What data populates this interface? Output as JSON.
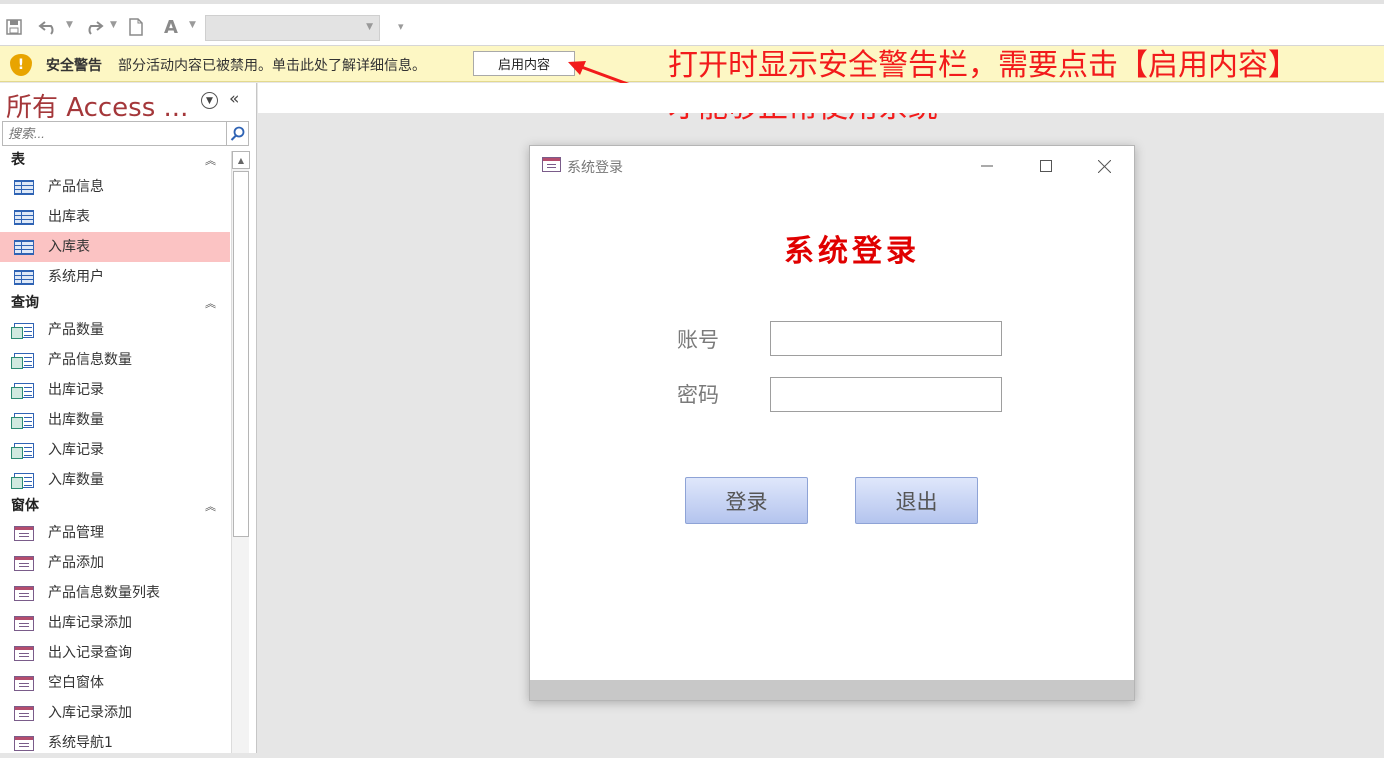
{
  "security_bar": {
    "title": "安全警告",
    "message": "部分活动内容已被禁用。单击此处了解详细信息。",
    "enable_button": "启用内容"
  },
  "annotation": {
    "line1": "打开时显示安全警告栏，需要点击【启用内容】",
    "line2": "才能够正常使用系统",
    "color": "#f21b1b"
  },
  "nav": {
    "header": "所有 Access ...",
    "search_placeholder": "搜索...",
    "groups": [
      {
        "label": "表",
        "items": [
          {
            "label": "产品信息"
          },
          {
            "label": "出库表"
          },
          {
            "label": "入库表",
            "selected": true
          },
          {
            "label": "系统用户"
          }
        ]
      },
      {
        "label": "查询",
        "items": [
          {
            "label": "产品数量"
          },
          {
            "label": "产品信息数量"
          },
          {
            "label": "出库记录"
          },
          {
            "label": "出库数量"
          },
          {
            "label": "入库记录"
          },
          {
            "label": "入库数量"
          }
        ]
      },
      {
        "label": "窗体",
        "items": [
          {
            "label": "产品管理"
          },
          {
            "label": "产品添加"
          },
          {
            "label": "产品信息数量列表"
          },
          {
            "label": "出库记录添加"
          },
          {
            "label": "出入记录查询"
          },
          {
            "label": "空白窗体"
          },
          {
            "label": "入库记录添加"
          },
          {
            "label": "系统导航1"
          }
        ]
      }
    ]
  },
  "dialog": {
    "window_title": "系统登录",
    "heading": "系统登录",
    "account_label": "账号",
    "password_label": "密码",
    "account_value": "",
    "password_value": "",
    "login_button": "登录",
    "exit_button": "退出",
    "heading_color": "#e00000"
  }
}
